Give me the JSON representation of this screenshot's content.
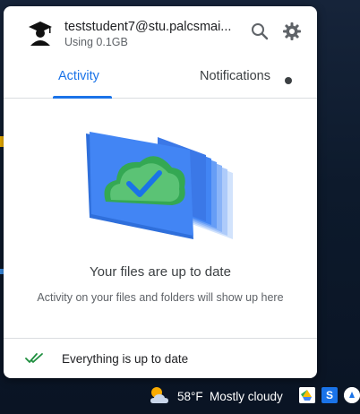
{
  "account": {
    "email": "teststudent7@stu.palcsmai...",
    "usage": "Using 0.1GB"
  },
  "header": {
    "search_icon": "search-icon",
    "settings_icon": "gear-icon"
  },
  "tabs": [
    {
      "label": "Activity",
      "active": true
    },
    {
      "label": "Notifications",
      "active": false,
      "has_dot": true
    }
  ],
  "status": {
    "title": "Your files are up to date",
    "subtitle": "Activity on your files and folders will show up here"
  },
  "footer": {
    "text": "Everything is up to date"
  },
  "taskbar": {
    "temperature": "58°F",
    "condition": "Mostly cloudy",
    "tray_s_label": "S"
  },
  "colors": {
    "accent": "#1a73e8",
    "check_green": "#1e8e3e",
    "cloud_green": "#34a853"
  }
}
